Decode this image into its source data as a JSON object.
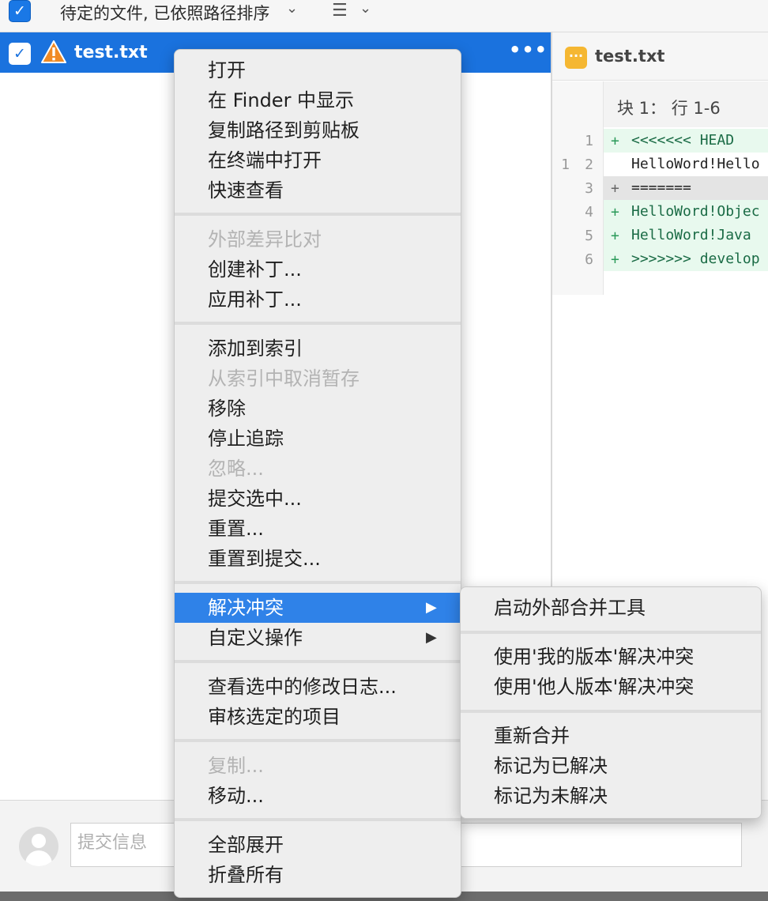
{
  "toolbar": {
    "filter_label": "待定的文件, 已依照路径排序",
    "checkbox_mark": "✓",
    "chevron": "⌄",
    "list_glyph": "☰"
  },
  "file_list": {
    "items": [
      {
        "name": "test.txt",
        "status_icon": "warning-icon",
        "more": "•••",
        "checked": true
      }
    ]
  },
  "diff": {
    "file_name": "test.txt",
    "badge": "···",
    "hunk_title": "块 1： 行 1-6",
    "lines": [
      {
        "old": "",
        "new": "1",
        "marker": "+",
        "text": "<<<<<<< HEAD",
        "kind": "add"
      },
      {
        "old": "1",
        "new": "2",
        "marker": "",
        "text": "HelloWord!Hello",
        "kind": "ctx"
      },
      {
        "old": "",
        "new": "3",
        "marker": "+",
        "text": "=======",
        "kind": "sep"
      },
      {
        "old": "",
        "new": "4",
        "marker": "+",
        "text": "HelloWord!Objec",
        "kind": "add"
      },
      {
        "old": "",
        "new": "5",
        "marker": "+",
        "text": "HelloWord!Java",
        "kind": "add"
      },
      {
        "old": "",
        "new": "6",
        "marker": "+",
        "text": ">>>>>>> develop",
        "kind": "add"
      }
    ]
  },
  "context_menu": {
    "items": {
      "open": "打开",
      "show_in_finder": "在 Finder 中显示",
      "copy_path": "复制路径到剪贴板",
      "open_in_terminal": "在终端中打开",
      "quick_look": "快速查看",
      "external_diff": "外部差异比对",
      "create_patch": "创建补丁...",
      "apply_patch": "应用补丁...",
      "add_to_index": "添加到索引",
      "unstage": "从索引中取消暂存",
      "remove": "移除",
      "stop_tracking": "停止追踪",
      "ignore": "忽略...",
      "commit_selected": "提交选中...",
      "reset": "重置...",
      "reset_to_commit": "重置到提交...",
      "resolve_conflicts": "解决冲突",
      "custom_actions": "自定义操作",
      "view_log": "查看选中的修改日志...",
      "review_selected": "审核选定的项目",
      "copy": "复制...",
      "move": "移动...",
      "expand_all": "全部展开",
      "collapse_all": "折叠所有"
    },
    "submenu_arrow": "▶"
  },
  "resolve_submenu": {
    "launch_merge_tool": "启动外部合并工具",
    "resolve_mine": "使用'我的版本'解决冲突",
    "resolve_theirs": "使用'他人版本'解决冲突",
    "re_merge": "重新合并",
    "mark_resolved": "标记为已解决",
    "mark_unresolved": "标记为未解决"
  },
  "commit": {
    "placeholder": "提交信息"
  },
  "colors": {
    "selection_blue": "#1a72de",
    "menu_highlight": "#2f82e8",
    "diff_add_bg": "#e8f9ee",
    "warning_orange": "#f08a24"
  }
}
